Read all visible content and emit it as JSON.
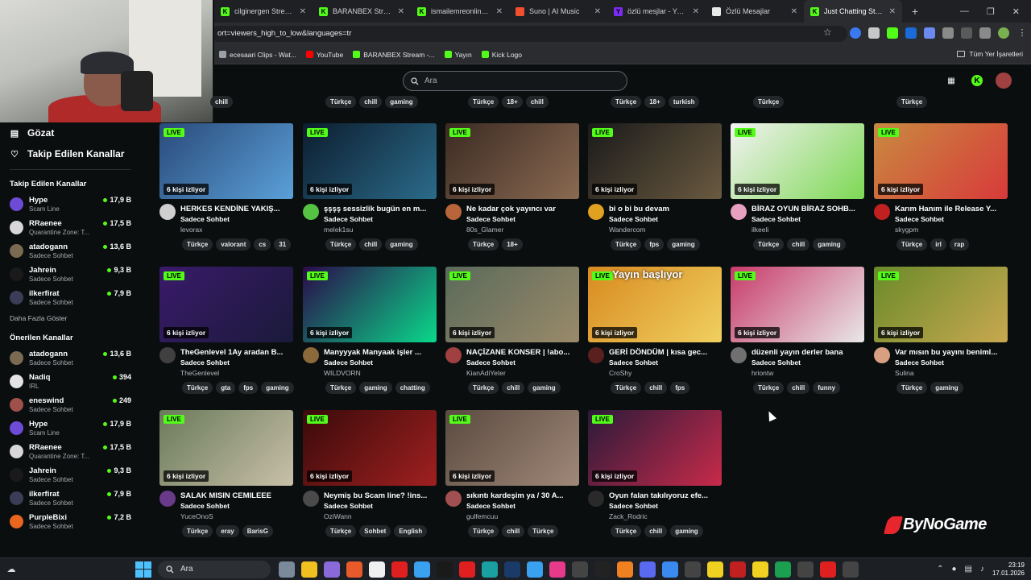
{
  "browser": {
    "tabs": [
      {
        "title": "cilginergen Stream - ",
        "icon_color": "#53fc18",
        "icon_letter": "K"
      },
      {
        "title": "BARANBEX Stream - ",
        "icon_color": "#53fc18",
        "icon_letter": "K"
      },
      {
        "title": "ismailemreonline Stre",
        "icon_color": "#53fc18",
        "icon_letter": "K"
      },
      {
        "title": "Suno | AI Music",
        "icon_color": "#f0502e",
        "icon_letter": ""
      },
      {
        "title": "özlü mesjlar - Yahoo",
        "icon_color": "#7b2cf3",
        "icon_letter": "Y"
      },
      {
        "title": "Özlü Mesajlar",
        "icon_color": "#e8e8e8",
        "icon_letter": ""
      },
      {
        "title": "Just Chatting Stream",
        "icon_color": "#53fc18",
        "icon_letter": "K",
        "active": true
      }
    ],
    "url": "ort=viewers_high_to_low&languages=tr",
    "bookmarks": [
      {
        "label": "ecesaari Clips - Wat...",
        "color": "#9aa0a6"
      },
      {
        "label": "YouTube",
        "color": "#ff0000"
      },
      {
        "label": "BARANBEX Stream -...",
        "color": "#53fc18"
      },
      {
        "label": "Yayın",
        "color": "#53fc18"
      },
      {
        "label": "Kick Logo",
        "color": "#53fc18"
      }
    ],
    "all_bookmarks": "Tüm Yer İşaretleri"
  },
  "search": {
    "placeholder": "Ara"
  },
  "sidebar": {
    "nav": [
      {
        "label": "Gözat",
        "icon": "browse-icon"
      },
      {
        "label": "Takip Edilen Kanallar",
        "icon": "heart-icon"
      }
    ],
    "followed_title": "Takip Edilen Kanallar",
    "followed": [
      {
        "name": "Hype",
        "cat": "Scam Line",
        "viewers": "17,9 B",
        "color": "#6d4bd6"
      },
      {
        "name": "RRaenee",
        "cat": "Quarantine Zone: T...",
        "viewers": "17,5 B",
        "color": "#d7d7d7"
      },
      {
        "name": "atadogann",
        "cat": "Sadece Sohbet",
        "viewers": "13,6 B",
        "color": "#7a6a52"
      },
      {
        "name": "Jahrein",
        "cat": "Sadece Sohbet",
        "viewers": "9,3 B",
        "color": "#1a1a1a"
      },
      {
        "name": "ilkerfirat",
        "cat": "Sadece Sohbet",
        "viewers": "7,9 B",
        "color": "#3a3d55"
      }
    ],
    "show_more": "Daha Fazla Göster",
    "recommended_title": "Önerilen Kanallar",
    "recommended": [
      {
        "name": "atadogann",
        "cat": "Sadece Sohbet",
        "viewers": "13,6 B",
        "color": "#7a6a52"
      },
      {
        "name": "Nadiq",
        "cat": "IRL",
        "viewers": "394",
        "color": "#e3e3e3"
      },
      {
        "name": "eneswind",
        "cat": "Sadece Sohbet",
        "viewers": "249",
        "color": "#a0504a"
      },
      {
        "name": "Hype",
        "cat": "Scam Line",
        "viewers": "17,9 B",
        "color": "#6d4bd6"
      },
      {
        "name": "RRaenee",
        "cat": "Quarantine Zone: T...",
        "viewers": "17,5 B",
        "color": "#d7d7d7"
      },
      {
        "name": "Jahrein",
        "cat": "Sadece Sohbet",
        "viewers": "9,3 B",
        "color": "#1a1a1a"
      },
      {
        "name": "ilkerfirat",
        "cat": "Sadece Sohbet",
        "viewers": "7,9 B",
        "color": "#3a3d55"
      },
      {
        "name": "PurpleBixi",
        "cat": "Sadece Sohbet",
        "viewers": "7,2 B",
        "color": "#e8661e"
      }
    ]
  },
  "top_tags": [
    [
      "chill"
    ],
    [
      "Türkçe",
      "chill",
      "gaming"
    ],
    [
      "Türkçe",
      "18+",
      "chill"
    ],
    [
      "Türkçe",
      "18+",
      "turkish"
    ],
    [
      "Türkçe"
    ],
    [
      "Türkçe"
    ]
  ],
  "streams": [
    {
      "title": "HERKES KENDİNE YAKIŞ...",
      "cat": "Sadece Sohbet",
      "channel": "levorax",
      "viewers": "6 kişi izliyor",
      "live": "LIVE",
      "tags": [
        "Türkçe",
        "valorant",
        "cs",
        "31"
      ],
      "thumb": [
        "#2a4a7a",
        "#5aa0d8"
      ],
      "avatar": "#cfcfcf"
    },
    {
      "title": "şşşş sessizlik bugün en m...",
      "cat": "Sadece Sohbet",
      "channel": "melek1su",
      "viewers": "6 kişi izliyor",
      "live": "LIVE",
      "tags": [
        "Türkçe",
        "chill",
        "gaming"
      ],
      "thumb": [
        "#0c1d2e",
        "#2b6b8a"
      ],
      "avatar": "#55c244"
    },
    {
      "title": "Ne kadar çok yayıncı var",
      "cat": "Sadece Sohbet",
      "channel": "80s_Glamer",
      "viewers": "6 kişi izliyor",
      "live": "LIVE",
      "tags": [
        "Türkçe",
        "18+"
      ],
      "thumb": [
        "#3b2a22",
        "#8a6a52"
      ],
      "avatar": "#b8653b"
    },
    {
      "title": "bi o bi bu devam",
      "cat": "Sadece Sohbet",
      "channel": "Wandercom",
      "viewers": "6 kişi izliyor",
      "live": "LIVE",
      "tags": [
        "Türkçe",
        "fps",
        "gaming"
      ],
      "thumb": [
        "#1a1a1a",
        "#6a5a40"
      ],
      "avatar": "#e0a020"
    },
    {
      "title": "BİRAZ OYUN BİRAZ SOHB...",
      "cat": "Sadece Sohbet",
      "channel": "ilkeeli",
      "viewers": "6 kişi izliyor",
      "live": "LIVE",
      "tags": [
        "Türkçe",
        "chill",
        "gaming"
      ],
      "thumb": [
        "#f2f2f2",
        "#7dd854"
      ],
      "avatar": "#e8a0c0"
    },
    {
      "title": "Karım Hanım ile Release Y...",
      "cat": "Sadece Sohbet",
      "channel": "skygpm",
      "viewers": "6 kişi izliyor",
      "live": "LIVE",
      "tags": [
        "Türkçe",
        "irl",
        "rap"
      ],
      "thumb": [
        "#c98a40",
        "#d83a3a"
      ],
      "avatar": "#c02020"
    },
    {
      "title": "TheGenlevel 1Ay aradan B...",
      "cat": "Sadece Sohbet",
      "channel": "TheGenlevel",
      "viewers": "6 kişi izliyor",
      "live": "LIVE",
      "tags": [
        "Türkçe",
        "gta",
        "fps",
        "gaming"
      ],
      "thumb": [
        "#3a1a6a",
        "#1a1a3a"
      ],
      "avatar": "#404040"
    },
    {
      "title": "Manyyyak Manyaak işler ...",
      "cat": "Sadece Sohbet",
      "channel": "WILDVORN",
      "viewers": "6 kişi izliyor",
      "live": "LIVE",
      "tags": [
        "Türkçe",
        "gaming",
        "chatting"
      ],
      "thumb": [
        "#2a0a4a",
        "#0ad88a"
      ],
      "avatar": "#8a6a3a"
    },
    {
      "title": "NAÇİZANE KONSER | !abo...",
      "cat": "Sadece Sohbet",
      "channel": "KianAdiYeter",
      "viewers": "6 kişi izliyor",
      "live": "LIVE",
      "tags": [
        "Türkçe",
        "chill",
        "gaming"
      ],
      "thumb": [
        "#5a6a5a",
        "#9a8a6a"
      ],
      "avatar": "#a04040"
    },
    {
      "title": "GERİ DÖNDÜM | kısa gec...",
      "cat": "Sadece Sohbet",
      "channel": "CroShy",
      "viewers": "6 kişi izliyor",
      "live": "LIVE",
      "tags": [
        "Türkçe",
        "chill",
        "fps"
      ],
      "thumb": [
        "#d88a20",
        "#f0d060"
      ],
      "avatar": "#5a2020",
      "overlay_text": "Yayın başlıyor"
    },
    {
      "title": "düzenli yayın derler bana",
      "cat": "Sadece Sohbet",
      "channel": "hriontw",
      "viewers": "6 kişi izliyor",
      "live": "LIVE",
      "tags": [
        "Türkçe",
        "chill",
        "funny"
      ],
      "thumb": [
        "#c83a6a",
        "#e8e8e8"
      ],
      "avatar": "#707070"
    },
    {
      "title": "Var mısın bu yayını beniml...",
      "cat": "Sadece Sohbet",
      "channel": "Sulina",
      "viewers": "6 kişi izliyor",
      "live": "LIVE",
      "tags": [
        "Türkçe",
        "gaming"
      ],
      "thumb": [
        "#6a8a2a",
        "#c8a850"
      ],
      "avatar": "#d8a080"
    },
    {
      "title": "SALAK MISIN CEMILEEE",
      "cat": "Sadece Sohbet",
      "channel": "YuceOnoS",
      "viewers": "6 kişi izliyor",
      "live": "LIVE",
      "tags": [
        "Türkçe",
        "eray",
        "BarisG"
      ],
      "thumb": [
        "#6a7a5a",
        "#c8c0a8"
      ],
      "avatar": "#6a3a8a"
    },
    {
      "title": "Neymiş bu Scam line? !ins...",
      "cat": "Sadece Sohbet",
      "channel": "OziWann",
      "viewers": "6 kişi izliyor",
      "live": "LIVE",
      "tags": [
        "Türkçe",
        "Sohbet",
        "English"
      ],
      "thumb": [
        "#3a0a0a",
        "#a02020"
      ],
      "avatar": "#4a4a4a"
    },
    {
      "title": "sıkıntı kardeşim ya / 30 A...",
      "cat": "Sadece Sohbet",
      "channel": "gulfemcuu",
      "viewers": "6 kişi izliyor",
      "live": "LIVE",
      "tags": [
        "Türkçe",
        "chill",
        "Türkçe"
      ],
      "thumb": [
        "#5a4a40",
        "#a08878"
      ],
      "avatar": "#a05050"
    },
    {
      "title": "Oyun falan takılıyoruz efe...",
      "cat": "Sadece Sohbet",
      "channel": "Zack_Rodric",
      "viewers": "6 kişi izliyor",
      "live": "LIVE",
      "tags": [
        "Türkçe",
        "chill",
        "gaming"
      ],
      "thumb": [
        "#2a1a3a",
        "#c82a4a"
      ],
      "avatar": "#2a2a2a"
    }
  ],
  "watermark": "ByNoGame",
  "taskbar": {
    "search": "Ara",
    "time": "23:19",
    "date": "17.01.2026",
    "apps": [
      "#7a8a9a",
      "#f0c020",
      "#8a6ad8",
      "#e85a2a",
      "#f0f0f0",
      "#e02020",
      "#3aa0f0",
      "#1a1a1a",
      "#e02020",
      "#1aa0a0",
      "#1a3a6a",
      "#3aa0f0",
      "#e83a8a",
      "#444",
      "#222",
      "#f08020",
      "#5a6af0",
      "#3a8af0",
      "#444",
      "#f0d020",
      "#c02020",
      "#f0d020",
      "#1aa050",
      "#444",
      "#e02020",
      "#444"
    ]
  }
}
